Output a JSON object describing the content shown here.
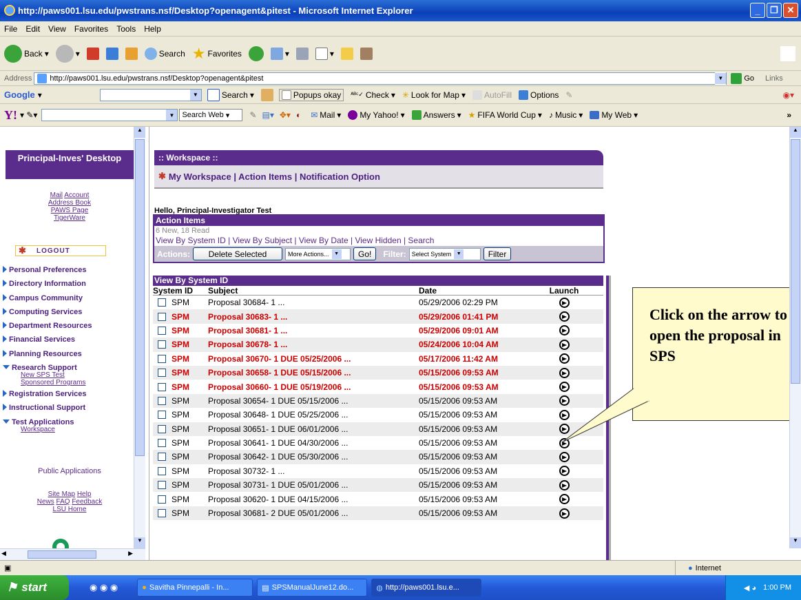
{
  "window": {
    "title": "http://paws001.lsu.edu/pwstrans.nsf/Desktop?openagent&pitest - Microsoft Internet Explorer"
  },
  "menu": [
    "File",
    "Edit",
    "View",
    "Favorites",
    "Tools",
    "Help"
  ],
  "toolbar": {
    "back": "Back",
    "search": "Search",
    "favorites": "Favorites"
  },
  "address": {
    "label": "Address",
    "url": "http://paws001.lsu.edu/pwstrans.nsf/Desktop?openagent&pitest",
    "go": "Go",
    "links": "Links"
  },
  "google": {
    "brand": "Google",
    "search": "Search",
    "popups": "Popups okay",
    "check": "Check",
    "map": "Look for Map",
    "autofill": "AutoFill",
    "options": "Options"
  },
  "yahoo": {
    "search_web": "Search Web",
    "mail": "Mail",
    "my_yahoo": "My Yahoo!",
    "answers": "Answers",
    "fifa": "FIFA World Cup",
    "music": "Music",
    "my_web": "My Web"
  },
  "left": {
    "header": "Principal-Inves' Desktop",
    "links1": [
      "Mail",
      "Account"
    ],
    "links2": [
      "Address Book",
      "PAWS Page",
      "TigerWare"
    ],
    "logout": "LOGOUT",
    "nav": [
      {
        "label": "Personal Preferences",
        "expanded": false
      },
      {
        "label": "Directory Information",
        "expanded": false
      },
      {
        "label": "Campus Community",
        "expanded": false
      },
      {
        "label": "Computing Services",
        "expanded": false
      },
      {
        "label": "Department Resources",
        "expanded": false
      },
      {
        "label": "Financial Services",
        "expanded": false
      },
      {
        "label": "Planning Resources",
        "expanded": false
      }
    ],
    "research": "Research Support",
    "research_sub": [
      "New SPS Test",
      "Sponsored Programs"
    ],
    "nav2": [
      "Registration Services",
      "Instructional Support"
    ],
    "test_apps": "Test Applications",
    "test_sub": "Workspace",
    "public": "Public Applications",
    "bottom1": [
      "Site Map",
      "Help"
    ],
    "bottom2": [
      "News",
      "FAQ",
      "Feedback"
    ],
    "bottom3": "LSU Home"
  },
  "workspace": {
    "header": ":: Workspace ::",
    "nav": "My Workspace | Action Items | Notification Option",
    "hello": "Hello, Principal-Investigator Test"
  },
  "action_items": {
    "title": "Action Items",
    "count": "6 New, 18 Read",
    "views": "View By System ID  | View By Subject | View By Date | View Hidden  | Search",
    "actions_label": "Actions:",
    "delete": "Delete Selected",
    "more": "More Actions...",
    "go": "Go!",
    "filter_label": "Filter:",
    "select_system": "Select System",
    "filter_btn": "Filter"
  },
  "table": {
    "title": "View By System ID",
    "headers": [
      "System ID",
      "Subject",
      "Date",
      "Launch"
    ],
    "rows": [
      {
        "sys": "SPM",
        "subject": "Proposal 30684- 1 ...",
        "date": "05/29/2006 02:29 PM",
        "new": false
      },
      {
        "sys": "SPM",
        "subject": "Proposal 30683- 1 ...",
        "date": "05/29/2006 01:41 PM",
        "new": true
      },
      {
        "sys": "SPM",
        "subject": "Proposal 30681- 1 ...",
        "date": "05/29/2006 09:01 AM",
        "new": true
      },
      {
        "sys": "SPM",
        "subject": "Proposal 30678- 1 ...",
        "date": "05/24/2006 10:04 AM",
        "new": true
      },
      {
        "sys": "SPM",
        "subject": "Proposal 30670- 1 DUE 05/25/2006 ...",
        "date": "05/17/2006 11:42 AM",
        "new": true
      },
      {
        "sys": "SPM",
        "subject": "Proposal 30658- 1 DUE 05/15/2006 ...",
        "date": "05/15/2006 09:53 AM",
        "new": true
      },
      {
        "sys": "SPM",
        "subject": "Proposal 30660- 1 DUE 05/19/2006 ...",
        "date": "05/15/2006 09:53 AM",
        "new": true
      },
      {
        "sys": "SPM",
        "subject": "Proposal 30654- 1 DUE 05/15/2006 ...",
        "date": "05/15/2006 09:53 AM",
        "new": false
      },
      {
        "sys": "SPM",
        "subject": "Proposal 30648- 1 DUE 05/25/2006 ...",
        "date": "05/15/2006 09:53 AM",
        "new": false
      },
      {
        "sys": "SPM",
        "subject": "Proposal 30651- 1 DUE 06/01/2006 ...",
        "date": "05/15/2006 09:53 AM",
        "new": false
      },
      {
        "sys": "SPM",
        "subject": "Proposal 30641- 1 DUE 04/30/2006 ...",
        "date": "05/15/2006 09:53 AM",
        "new": false
      },
      {
        "sys": "SPM",
        "subject": "Proposal 30642- 1 DUE 05/30/2006 ...",
        "date": "05/15/2006 09:53 AM",
        "new": false
      },
      {
        "sys": "SPM",
        "subject": "Proposal 30732- 1 ...",
        "date": "05/15/2006 09:53 AM",
        "new": false
      },
      {
        "sys": "SPM",
        "subject": "Proposal 30731- 1 DUE 05/01/2006 ...",
        "date": "05/15/2006 09:53 AM",
        "new": false
      },
      {
        "sys": "SPM",
        "subject": "Proposal 30620- 1 DUE 04/15/2006 ...",
        "date": "05/15/2006 09:53 AM",
        "new": false
      },
      {
        "sys": "SPM",
        "subject": "Proposal 30681- 2 DUE 05/01/2006 ...",
        "date": "05/15/2006 09:53 AM",
        "new": false
      }
    ]
  },
  "callout": "Click on the arrow to open the proposal in SPS",
  "status": {
    "zone": "Internet"
  },
  "taskbar": {
    "start": "start",
    "tasks": [
      "Savitha Pinnepalli - In...",
      "SPSManualJune12.do...",
      "http://paws001.lsu.e..."
    ],
    "clock": "1:00 PM"
  }
}
